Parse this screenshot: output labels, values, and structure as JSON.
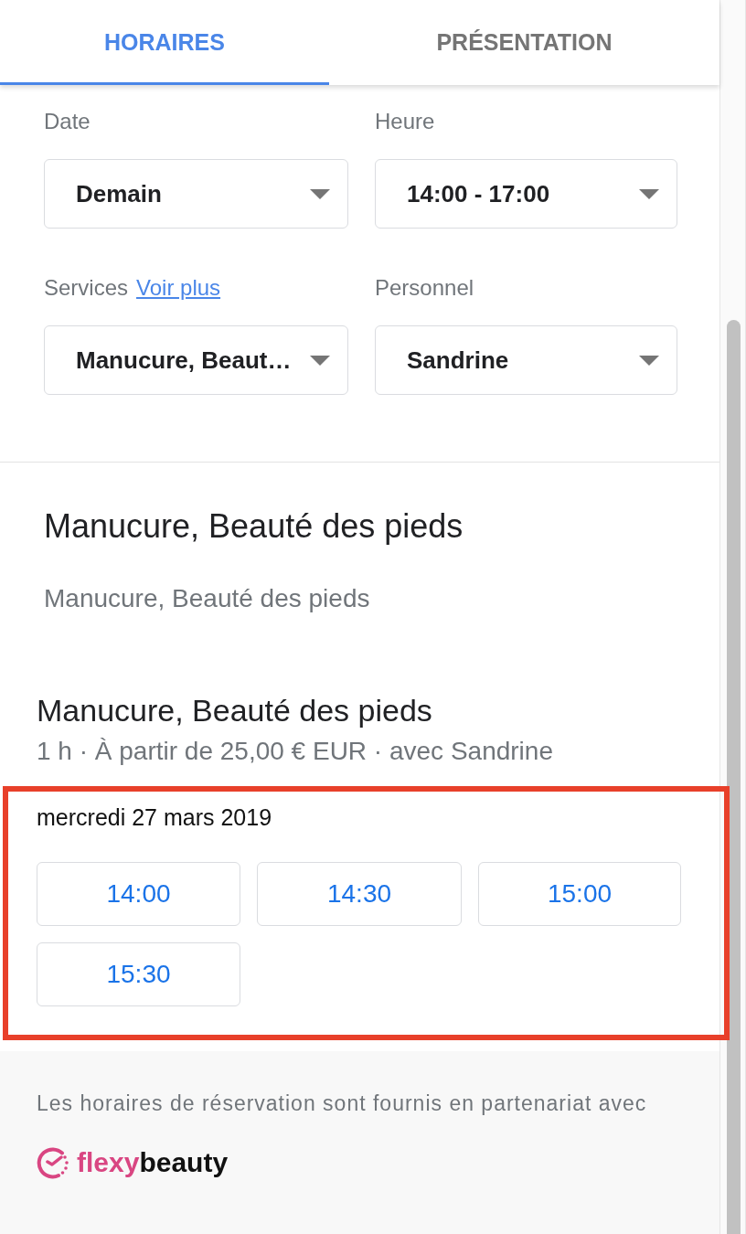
{
  "tabs": [
    {
      "label": "HORAIRES",
      "selected": true
    },
    {
      "label": "PRÉSENTATION",
      "selected": false
    }
  ],
  "filters": [
    {
      "label": "Date",
      "value": "Demain"
    },
    {
      "label": "Heure",
      "value": "14:00 - 17:00"
    },
    {
      "label": "Services",
      "link": "Voir plus",
      "value": "Manucure, Beaut…"
    },
    {
      "label": "Personnel",
      "value": "Sandrine"
    }
  ],
  "selection": {
    "title": "Manucure, Beauté des pieds",
    "subtitle": "Manucure, Beauté des pieds"
  },
  "service": {
    "name": "Manucure, Beauté des pieds",
    "details": "1 h · À partir de 25,00 € EUR · avec Sandrine"
  },
  "availability": {
    "highlighted": true,
    "date": "mercredi 27 mars 2019",
    "slots": [
      "14:00",
      "14:30",
      "15:00",
      "15:30"
    ]
  },
  "footer": {
    "note": "Les horaires de réservation sont fournis en partenariat avec",
    "logo": {
      "name_start": "flexy",
      "name_end": "beauty"
    }
  }
}
